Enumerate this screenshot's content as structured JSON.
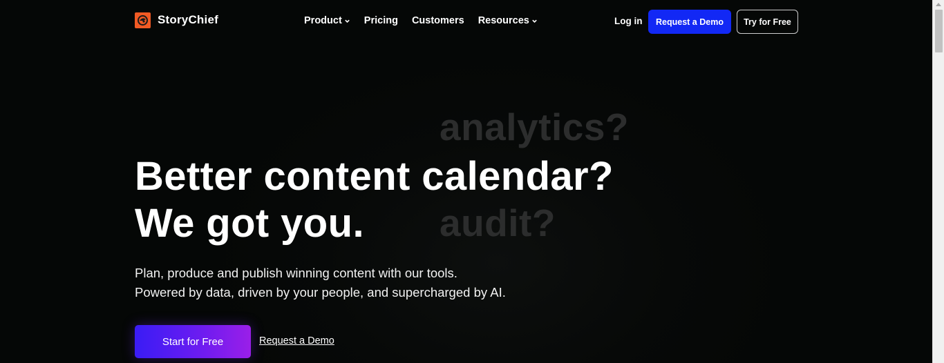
{
  "brand": {
    "name": "StoryChief",
    "accent_color": "#f15a24"
  },
  "nav": {
    "items": [
      {
        "label": "Product",
        "has_dropdown": true
      },
      {
        "label": "Pricing",
        "has_dropdown": false
      },
      {
        "label": "Customers",
        "has_dropdown": false
      },
      {
        "label": "Resources",
        "has_dropdown": true
      }
    ]
  },
  "header_actions": {
    "login_label": "Log in",
    "demo_label": "Request a Demo",
    "demo_color": "#1228f5",
    "try_label": "Try for Free"
  },
  "hero": {
    "ghost_words": [
      "analytics?",
      "audit?"
    ],
    "title_line1": "Better content calendar?",
    "title_line2": "We got you.",
    "subtitle_line1": "Plan, produce and publish winning content with our tools.",
    "subtitle_line2": "Powered by data, driven by your people, and supercharged by AI.",
    "cta_primary": "Start for Free",
    "cta_secondary": "Request a Demo",
    "cta_gradient": [
      "#3a1cf5",
      "#9a1fe8"
    ]
  }
}
